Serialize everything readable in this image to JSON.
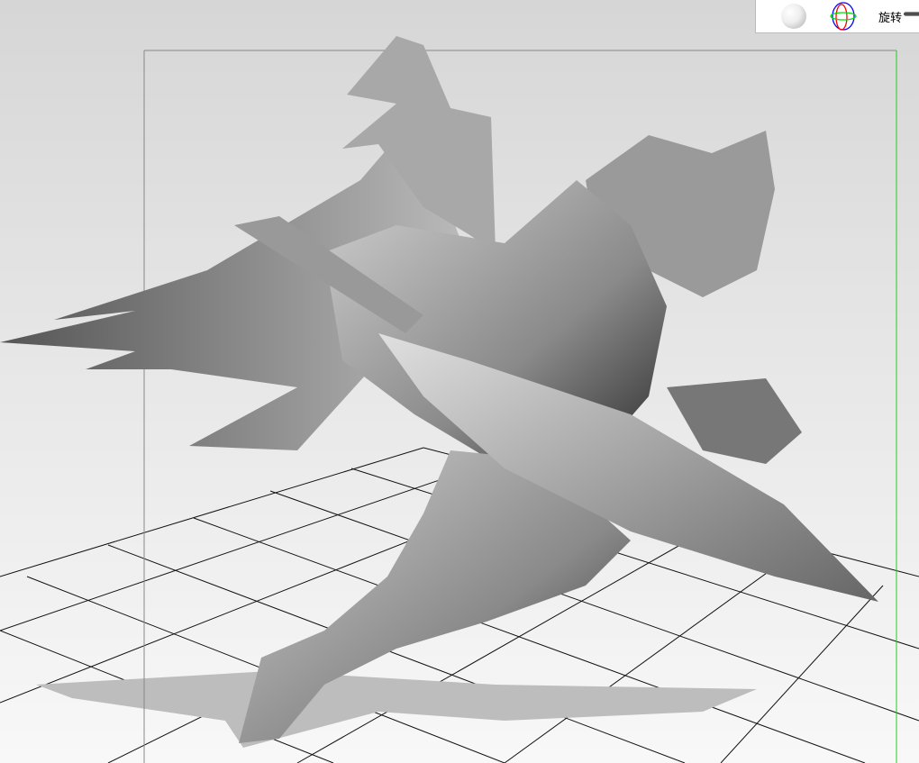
{
  "toolbar": {
    "shading_icon": "sphere-shading-icon",
    "gizmo_icon": "rotate-gizmo-icon",
    "rotate_label": "旋转"
  },
  "colors": {
    "frame_right": "#22cc22",
    "frame": "#888888",
    "grid": "#111111"
  }
}
